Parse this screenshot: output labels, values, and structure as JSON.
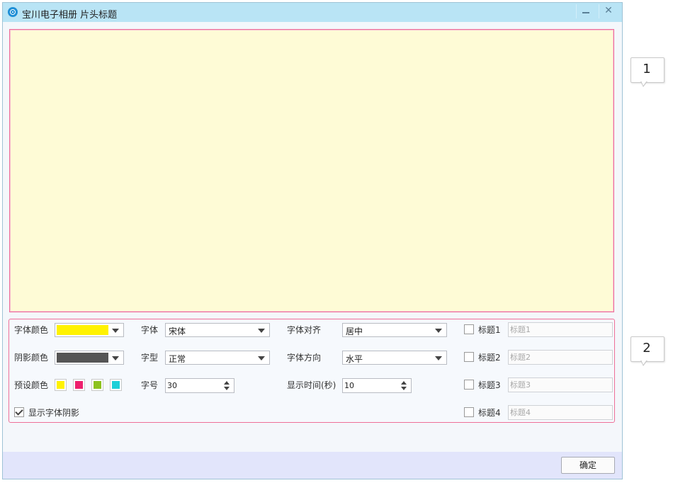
{
  "window": {
    "title": "宝川电子相册  片头标题",
    "minimize_icon": "minimize-icon",
    "close_icon": "close-icon",
    "close_glyph": "✕"
  },
  "settings": {
    "font_color": {
      "label": "字体颜色",
      "value": "#fff200"
    },
    "shadow_color": {
      "label": "阴影颜色",
      "value": "#555555"
    },
    "preset_colors": {
      "label": "预设颜色",
      "colors": [
        "#fff200",
        "#ee1f6e",
        "#8dc21f",
        "#1cd0d8"
      ]
    },
    "show_shadow": {
      "label": "显示字体阴影",
      "checked": true
    },
    "font": {
      "label": "字体",
      "value": "宋体"
    },
    "font_style": {
      "label": "字型",
      "value": "正常"
    },
    "font_size": {
      "label": "字号",
      "value": "30"
    },
    "align": {
      "label": "字体对齐",
      "value": "居中"
    },
    "direction": {
      "label": "字体方向",
      "value": "水平"
    },
    "duration": {
      "label": "显示时间(秒)",
      "value": "10"
    },
    "titles": [
      {
        "label": "标题1",
        "placeholder": "标题1",
        "checked": false
      },
      {
        "label": "标题2",
        "placeholder": "标题2",
        "checked": false
      },
      {
        "label": "标题3",
        "placeholder": "标题3",
        "checked": false
      },
      {
        "label": "标题4",
        "placeholder": "标题4",
        "checked": false
      }
    ]
  },
  "footer": {
    "ok_label": "确定"
  },
  "callouts": [
    "1",
    "2"
  ]
}
